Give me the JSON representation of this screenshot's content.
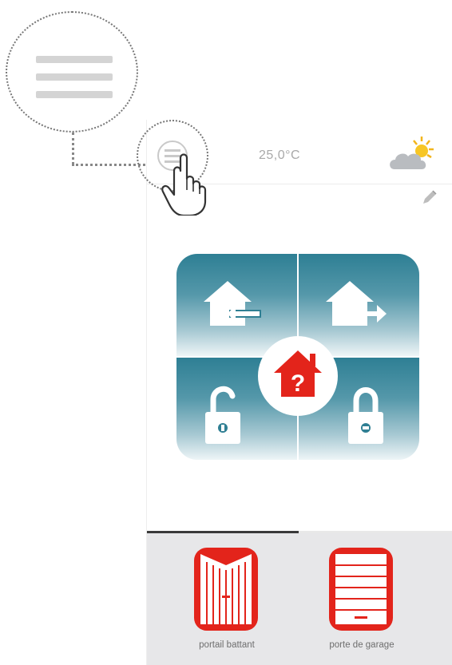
{
  "status": {
    "temperature": "25,0°C"
  },
  "icons": {
    "menu": "hamburger-menu-icon",
    "pointer": "hand-pointer-icon",
    "weather": "partly-sunny-icon",
    "edit": "pencil-icon",
    "scenario_home": "arrive-home-icon",
    "scenario_leave": "leave-home-icon",
    "scenario_unlock": "unlock-icon",
    "scenario_lock": "lock-icon",
    "scenario_unknown": "house-question-icon"
  },
  "center_button": {
    "symbol": "?"
  },
  "devices": [
    {
      "label": "portail battant",
      "icon": "swing-gate-icon"
    },
    {
      "label": "porte de garage",
      "icon": "garage-door-icon"
    }
  ],
  "colors": {
    "accent_red": "#e3241b",
    "tile_teal": "#2e7f94",
    "device_bar": "#e7e7e9"
  }
}
